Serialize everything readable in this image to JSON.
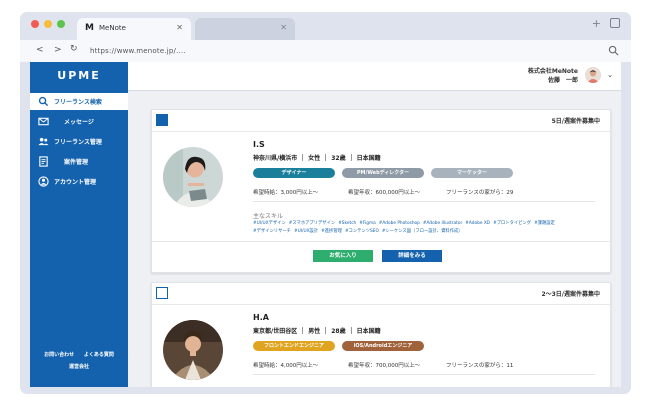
{
  "browser": {
    "tab_title": "MeNote",
    "tab_logo": "M",
    "url": "https://www.menote.jp/...."
  },
  "sidebar": {
    "logo": "UPME",
    "items": [
      {
        "label": "フリーランス検索",
        "icon": "search-icon",
        "active": true
      },
      {
        "label": "メッセージ",
        "icon": "mail-icon",
        "active": false
      },
      {
        "label": "フリーランス管理",
        "icon": "users-icon",
        "active": false
      },
      {
        "label": "案件管理",
        "icon": "document-icon",
        "active": false
      },
      {
        "label": "アカウント管理",
        "icon": "account-icon",
        "active": false
      }
    ],
    "footer": {
      "contact": "お問い合わせ",
      "faq": "よくある質問",
      "company": "運営会社"
    }
  },
  "header": {
    "company": "株式会社MeNote",
    "user": "佐藤　一郎"
  },
  "cards": [
    {
      "checked": true,
      "period": "5日/週案件募集中",
      "name": "I.S",
      "location": "神奈川県/横浜市",
      "gender": "女性",
      "age": "32歳",
      "nationality": "日本国籍",
      "roles": [
        {
          "label": "デザイナー",
          "color": "#1a7f9a"
        },
        {
          "label": "PM/Webディレクター",
          "color": "#8e9aa6"
        },
        {
          "label": "マーケッター",
          "color": "#a8b2bc"
        }
      ],
      "hourly": "希望時給：3,000円以上〜",
      "annual": "希望年収：600,000円以上〜",
      "fl_years": "フリーランスの家がら：29",
      "skills_heading": "主なスキル",
      "skills": [
        "#UI/UXデザイン",
        "#スマホアプリデザイン",
        "#Sketch",
        "#Figma",
        "#Adobe Photoshop",
        "#Adobe Illustrator",
        "#Adobe XD",
        "#プロトタイピング",
        "#課題設定",
        "#デザインリサーチ",
        "#UI/UX設計",
        "#進捗管理",
        "#コンテンツSEO",
        "#シーケンス図（フロー設計、資料作成）"
      ],
      "favorite_label": "お気に入り",
      "detail_label": "詳細をみる"
    },
    {
      "checked": false,
      "period": "2〜3日/週案件募集中",
      "name": "H.A",
      "location": "東京都/世田谷区",
      "gender": "男性",
      "age": "28歳",
      "nationality": "日本国籍",
      "roles": [
        {
          "label": "フロントエンドエンジニア",
          "color": "#e0a520"
        },
        {
          "label": "iOS/Androidエンジニア",
          "color": "#a0623a"
        }
      ],
      "hourly": "希望時給：4,000円以上〜",
      "annual": "希望年収：700,000円以上〜",
      "fl_years": "フリーランスの家がら：11"
    }
  ],
  "colors": {
    "brand": "#1462ae",
    "favorite": "#2eae6e",
    "detail": "#1462ae"
  }
}
